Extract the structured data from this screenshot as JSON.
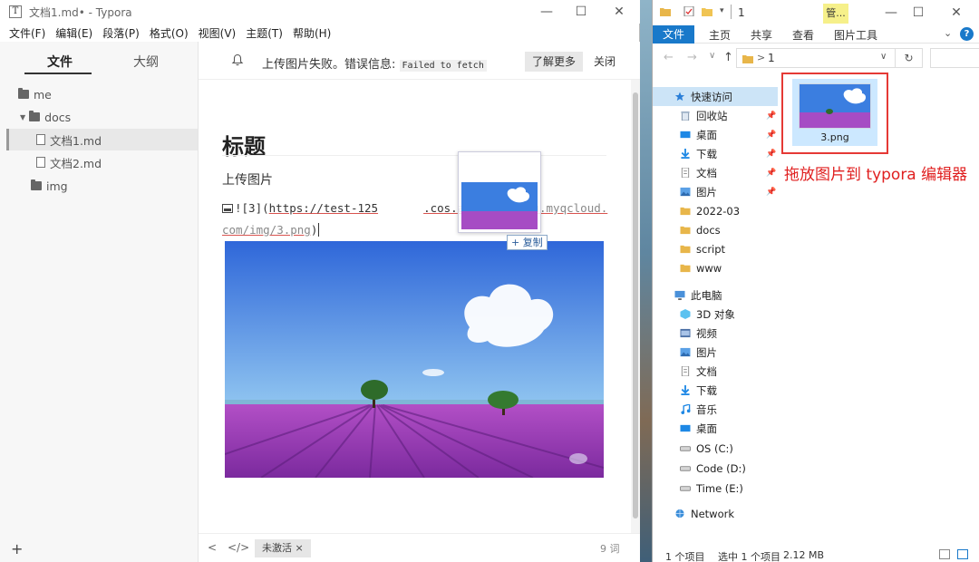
{
  "typora": {
    "title": "文档1.md• - Typora",
    "app_icon": "T",
    "menu": [
      "文件(F)",
      "编辑(E)",
      "段落(P)",
      "格式(O)",
      "视图(V)",
      "主题(T)",
      "帮助(H)"
    ],
    "sidebar": {
      "tab_files": "文件",
      "tab_outline": "大纲",
      "tree": [
        {
          "label": "me",
          "type": "folder"
        },
        {
          "label": "docs",
          "type": "folder-open"
        },
        {
          "label": "文档1.md",
          "type": "file",
          "active": true
        },
        {
          "label": "文档2.md",
          "type": "file"
        },
        {
          "label": "img",
          "type": "folder"
        }
      ],
      "add_label": "+"
    },
    "notice": {
      "message": "上传图片失败。错误信息:",
      "code": "Failed to fetch",
      "learn_more": "了解更多",
      "close": "关闭"
    },
    "editor": {
      "heading": "标题",
      "paragraph": "上传图片",
      "md_prefix": "![3](",
      "md_url_start": "https://test-125",
      "md_url_end": ".cos.",
      "md_url_obscured": "ap-guangzhou.myqcloud.com/img/3.png",
      "md_suffix": ")"
    },
    "drag": {
      "copy_label": "+ 复制"
    },
    "status": {
      "nav_left": "<",
      "nav_code": "</>",
      "badge": "未激活 ×",
      "words": "9 词"
    }
  },
  "explorer": {
    "title": "1",
    "manage_tab": "管...",
    "window_controls": {
      "minimize": "—",
      "maximize": "☐",
      "close": "✕"
    },
    "ribbon": {
      "file": "文件",
      "tabs": [
        "主页",
        "共享",
        "查看",
        "图片工具"
      ],
      "help": "?"
    },
    "address": {
      "path": "1",
      "separator": ">"
    },
    "nav": [
      {
        "label": "快速访问",
        "icon": "star-icon",
        "selected": true
      },
      {
        "label": "回收站",
        "icon": "recycle-bin-icon",
        "pinned": true
      },
      {
        "label": "桌面",
        "icon": "desktop-icon",
        "pinned": true
      },
      {
        "label": "下载",
        "icon": "download-icon",
        "pinned": true
      },
      {
        "label": "文档",
        "icon": "document-icon",
        "pinned": true
      },
      {
        "label": "图片",
        "icon": "pictures-icon",
        "pinned": true
      },
      {
        "label": "2022-03",
        "icon": "folder-icon"
      },
      {
        "label": "docs",
        "icon": "folder-icon"
      },
      {
        "label": "script",
        "icon": "folder-icon"
      },
      {
        "label": "www",
        "icon": "folder-icon"
      },
      {
        "label": "此电脑",
        "icon": "computer-icon"
      },
      {
        "label": "3D 对象",
        "icon": "3d-objects-icon"
      },
      {
        "label": "视频",
        "icon": "video-icon"
      },
      {
        "label": "图片",
        "icon": "pictures-icon"
      },
      {
        "label": "文档",
        "icon": "document-icon"
      },
      {
        "label": "下载",
        "icon": "download-icon"
      },
      {
        "label": "音乐",
        "icon": "music-icon"
      },
      {
        "label": "桌面",
        "icon": "desktop-icon"
      },
      {
        "label": "OS (C:)",
        "icon": "drive-icon"
      },
      {
        "label": "Code (D:)",
        "icon": "drive-icon"
      },
      {
        "label": "Time (E:)",
        "icon": "drive-icon"
      },
      {
        "label": "Network",
        "icon": "network-icon"
      }
    ],
    "file": {
      "name": "3.png"
    },
    "status": {
      "count": "1 个项目",
      "selected": "选中 1 个项目",
      "size": "2.12 MB"
    }
  },
  "annotation": "拖放图片到 typora 编辑器",
  "colors": {
    "accent": "#1979ca",
    "annotation_red": "#e53935",
    "selection": "#cce8ff"
  }
}
